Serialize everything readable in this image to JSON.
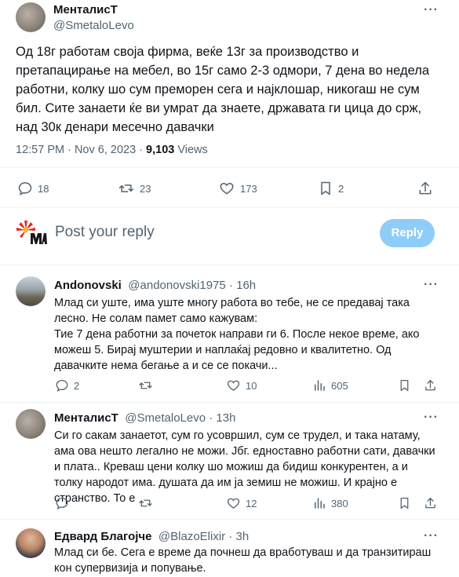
{
  "main_tweet": {
    "author_name": "МенталисТ",
    "author_handle": "@SmetaloLevo",
    "text": "Од 18г работам своја фирма, веќе 13г за производство и претапацирање на мебел, во 15г само 2-3 одмори, 7 дена во недела работни, колку шо сум преморен сега и најклошар, никогаш не сум бил. Сите занаети ќе ви умрат да знаете, државата ги цица до срж, над 30к денари месечно давачки",
    "time": "12:57 PM · Nov 6, 2023 · ",
    "views_count": "9,103",
    "views_label": " Views",
    "replies": "18",
    "retweets": "23",
    "likes": "173",
    "bookmarks": "2"
  },
  "compose": {
    "placeholder": "Post your reply",
    "reply_button": "Reply"
  },
  "replies": [
    {
      "name": "Andonovski",
      "handle": "@andonovski1975 · 16h",
      "text": "Млад си уште, има уште многу работа во тебе, не се предавај така лесно. Не солам памет само кажувам:\nТие 7 дена работни за почеток направи ги 6. После некое време,  ако можеш 5. Бирај муштерии и наплаќај редовно и квалитетно. Од давачките нема бегање а и се се покачи...",
      "replies": "2",
      "retweets": "",
      "likes": "10",
      "views": "605"
    },
    {
      "name": "МенталисТ",
      "handle": "@SmetaloLevo · 13h",
      "text": "Си го сакам занаетот, сум го усовршил, сум се трудел, и така натаму, ама ова нешто легално не можи. Јбг. едноставно работни сати, давачки и плата.. Креваш цени колку шо можиш да бидиш конкурентен, а и толку народот има. душата да им ја земиш не можиш. И крајно е странство. То е",
      "replies": "",
      "retweets": "",
      "likes": "12",
      "views": "380"
    },
    {
      "name": "Едвард Благојче",
      "handle": "@BlazoElixir · 3h",
      "text": "Млад си бе. Сега е време да почнеш да вработуваш и да транзитираш кон супервизија и попување."
    }
  ],
  "icons": {
    "more": "more-dots-icon",
    "reply": "reply-icon",
    "retweet": "retweet-icon",
    "like": "heart-icon",
    "bookmark": "bookmark-icon",
    "share": "share-icon",
    "views": "views-bar-icon"
  },
  "colors": {
    "text": "#0f1419",
    "secondary": "#536471",
    "reply_button": "#8ecdf8",
    "divider": "#eff3f4"
  }
}
